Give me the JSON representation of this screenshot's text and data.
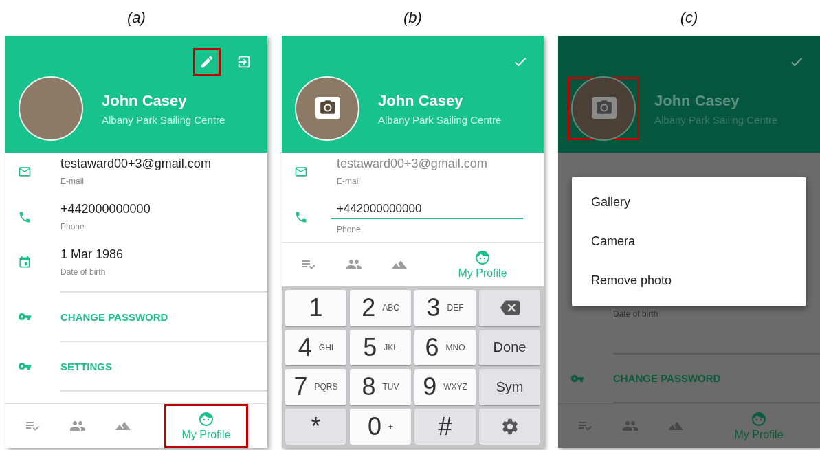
{
  "panels": [
    {
      "caption": "(a)",
      "dimmed": false,
      "header": {
        "actions": [
          {
            "kind": "edit",
            "highlighted": true
          },
          {
            "kind": "logout",
            "highlighted": false
          }
        ],
        "name": "John Casey",
        "club": "Albany Park Sailing Centre",
        "avatar": {
          "camera_overlay": false,
          "highlighted": false
        }
      },
      "fields": [
        {
          "kind": "email",
          "value": "testaward00+3@gmail.com",
          "label": "E-mail",
          "editing": false,
          "disabled": false
        },
        {
          "kind": "phone",
          "value": "+442000000000",
          "label": "Phone",
          "editing": false,
          "disabled": false
        },
        {
          "kind": "date",
          "value": "1 Mar 1986",
          "label": "Date of birth",
          "editing": false,
          "disabled": false
        }
      ],
      "links": [
        {
          "label": "CHANGE PASSWORD"
        },
        {
          "label": "SETTINGS"
        }
      ],
      "nav": [
        {
          "kind": "tasks",
          "selected": false,
          "highlighted": false
        },
        {
          "kind": "people",
          "selected": false,
          "highlighted": false
        },
        {
          "kind": "terrain",
          "selected": false,
          "highlighted": false
        },
        {
          "kind": "profile",
          "label": "My Profile",
          "selected": true,
          "highlighted": true
        }
      ]
    },
    {
      "caption": "(b)",
      "dimmed": false,
      "header": {
        "actions": [
          {
            "kind": "check",
            "highlighted": false
          }
        ],
        "name": "John Casey",
        "club": "Albany Park Sailing Centre",
        "avatar": {
          "camera_overlay": true,
          "highlighted": false
        }
      },
      "fields": [
        {
          "kind": "email",
          "value": "testaward00+3@gmail.com",
          "label": "E-mail",
          "editing": false,
          "disabled": true
        },
        {
          "kind": "phone",
          "value": "+442000000000",
          "label": "Phone",
          "editing": true,
          "disabled": false
        }
      ],
      "nav": [
        {
          "kind": "tasks",
          "selected": false,
          "highlighted": false
        },
        {
          "kind": "people",
          "selected": false,
          "highlighted": false
        },
        {
          "kind": "terrain",
          "selected": false,
          "highlighted": false
        },
        {
          "kind": "profile",
          "label": "My Profile",
          "selected": true,
          "highlighted": false
        }
      ],
      "keypad": [
        {
          "kind": "digit",
          "main": "1"
        },
        {
          "kind": "digit",
          "main": "2",
          "sub": "ABC"
        },
        {
          "kind": "digit",
          "main": "3",
          "sub": "DEF"
        },
        {
          "kind": "backspace"
        },
        {
          "kind": "digit",
          "main": "4",
          "sub": "GHI"
        },
        {
          "kind": "digit",
          "main": "5",
          "sub": "JKL"
        },
        {
          "kind": "digit",
          "main": "6",
          "sub": "MNO"
        },
        {
          "kind": "action",
          "main": "Done"
        },
        {
          "kind": "digit",
          "main": "7",
          "sub": "PQRS"
        },
        {
          "kind": "digit",
          "main": "8",
          "sub": "TUV"
        },
        {
          "kind": "digit",
          "main": "9",
          "sub": "WXYZ"
        },
        {
          "kind": "action",
          "main": "Sym"
        },
        {
          "kind": "symbol",
          "main": "*"
        },
        {
          "kind": "digit",
          "main": "0",
          "sub": "+"
        },
        {
          "kind": "symbol",
          "main": "#"
        },
        {
          "kind": "settings"
        }
      ]
    },
    {
      "caption": "(c)",
      "dimmed": true,
      "header": {
        "actions": [
          {
            "kind": "check",
            "highlighted": false
          }
        ],
        "name": "John Casey",
        "club": "Albany Park Sailing Centre",
        "avatar": {
          "camera_overlay": true,
          "highlighted": true
        }
      },
      "fields": [
        {
          "kind": "date",
          "label": "Date of birth"
        }
      ],
      "links": [
        {
          "label": "CHANGE PASSWORD"
        }
      ],
      "menu": [
        "Gallery",
        "Camera",
        "Remove photo"
      ],
      "nav": [
        {
          "kind": "tasks",
          "selected": false,
          "highlighted": false
        },
        {
          "kind": "people",
          "selected": false,
          "highlighted": false
        },
        {
          "kind": "terrain",
          "selected": false,
          "highlighted": false
        },
        {
          "kind": "profile",
          "label": "My Profile",
          "selected": true,
          "highlighted": false
        }
      ]
    }
  ]
}
